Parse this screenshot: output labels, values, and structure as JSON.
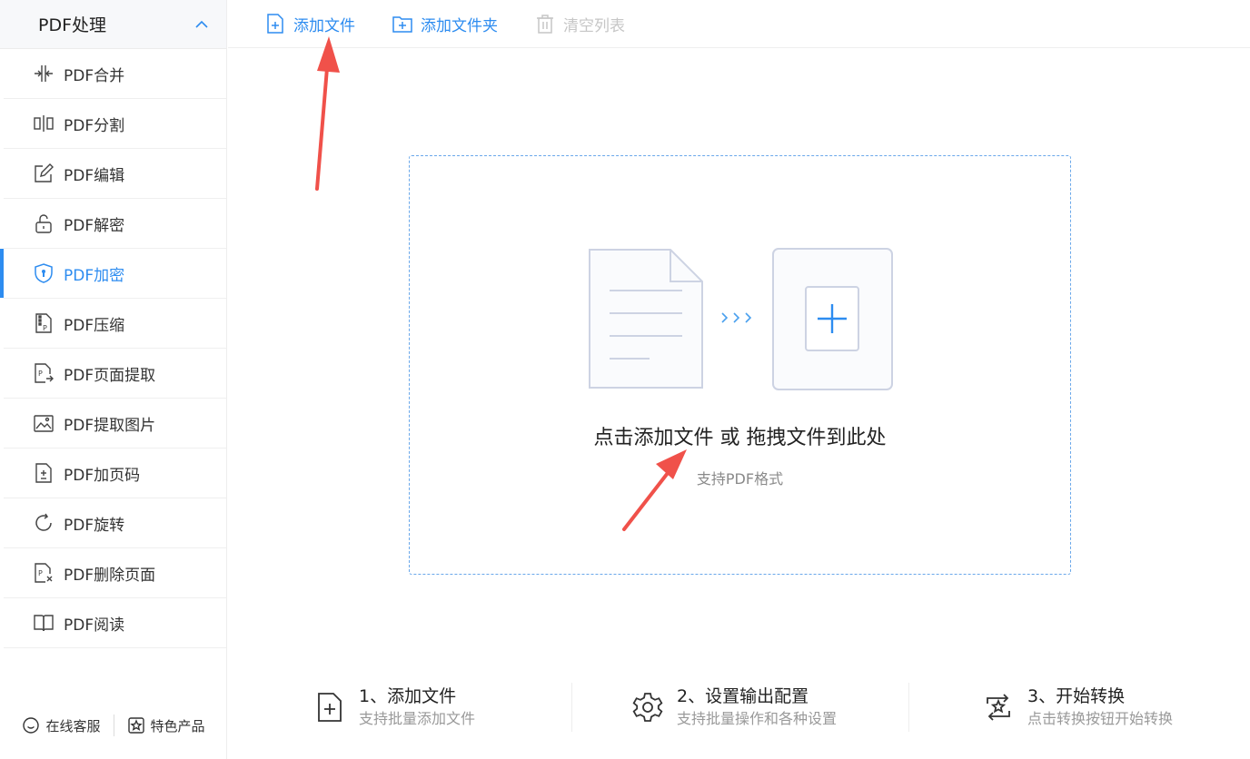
{
  "sidebar": {
    "title": "PDF处理",
    "items": [
      {
        "label": "PDF合并",
        "icon": "merge-icon"
      },
      {
        "label": "PDF分割",
        "icon": "split-icon"
      },
      {
        "label": "PDF编辑",
        "icon": "edit-icon"
      },
      {
        "label": "PDF解密",
        "icon": "unlock-icon"
      },
      {
        "label": "PDF加密",
        "icon": "shield-lock-icon",
        "active": true
      },
      {
        "label": "PDF压缩",
        "icon": "compress-icon"
      },
      {
        "label": "PDF页面提取",
        "icon": "page-extract-icon"
      },
      {
        "label": "PDF提取图片",
        "icon": "image-extract-icon"
      },
      {
        "label": "PDF加页码",
        "icon": "page-number-icon"
      },
      {
        "label": "PDF旋转",
        "icon": "rotate-icon"
      },
      {
        "label": "PDF删除页面",
        "icon": "delete-page-icon"
      },
      {
        "label": "PDF阅读",
        "icon": "book-icon"
      }
    ],
    "footer": {
      "service_label": "在线客服",
      "products_label": "特色产品"
    }
  },
  "toolbar": {
    "add_file": "添加文件",
    "add_folder": "添加文件夹",
    "clear_list": "清空列表"
  },
  "dropzone": {
    "main_text": "点击添加文件 或 拖拽文件到此处",
    "sub_text": "支持PDF格式"
  },
  "steps": [
    {
      "title": "1、添加文件",
      "desc": "支持批量添加文件",
      "icon": "add-file-icon"
    },
    {
      "title": "2、设置输出配置",
      "desc": "支持批量操作和各种设置",
      "icon": "gear-icon"
    },
    {
      "title": "3、开始转换",
      "desc": "点击转换按钮开始转换",
      "icon": "convert-icon"
    }
  ],
  "colors": {
    "accent": "#2d8cf0",
    "annotation_arrow": "#f0514a",
    "disabled": "#c6c6c6"
  }
}
